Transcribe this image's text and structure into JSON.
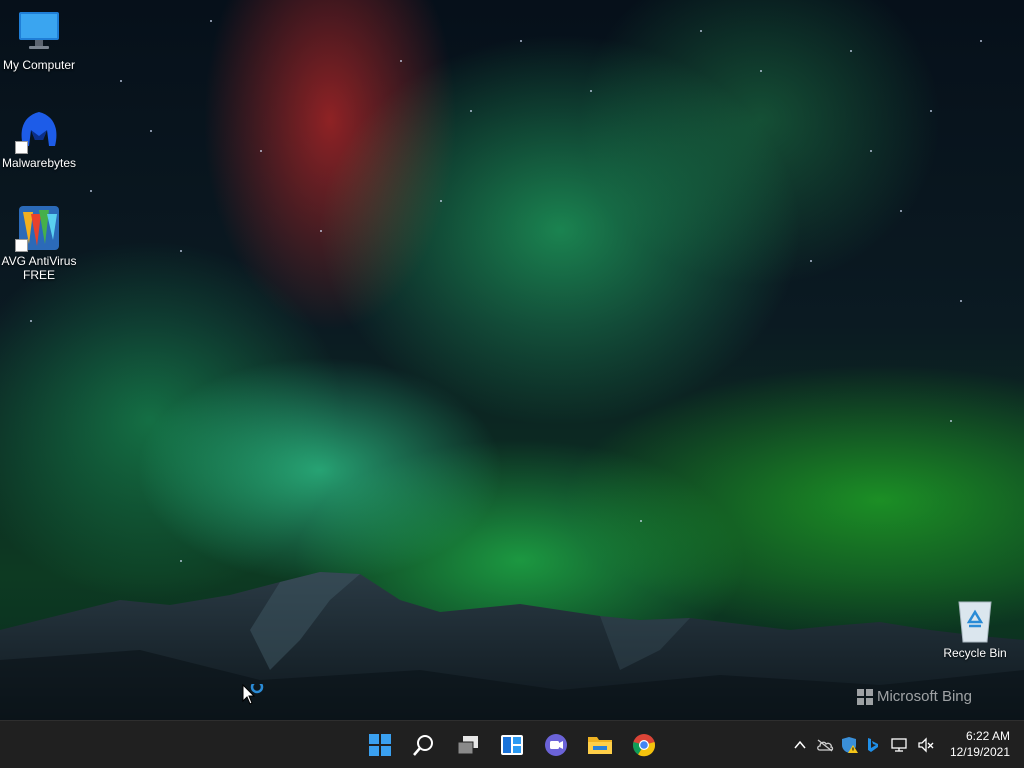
{
  "desktop": {
    "icons": [
      {
        "label": "My Computer"
      },
      {
        "label": "Malwarebytes"
      },
      {
        "label": "AVG AntiVirus FREE"
      },
      {
        "label": "Recycle Bin"
      }
    ],
    "watermark": "Microsoft Bing"
  },
  "taskbar": {
    "pinned": [
      {
        "icon": "windows-start-icon"
      },
      {
        "icon": "search-icon"
      },
      {
        "icon": "task-view-icon"
      },
      {
        "icon": "widgets-icon"
      },
      {
        "icon": "teams-chat-icon"
      },
      {
        "icon": "file-explorer-icon"
      },
      {
        "icon": "chrome-icon"
      }
    ],
    "tray": {
      "icons": [
        "chevron-up-icon",
        "onedrive-icon",
        "security-warning-icon",
        "bing-icon",
        "network-icon",
        "volume-muted-icon"
      ],
      "time": "6:22 AM",
      "date": "12/19/2021"
    }
  },
  "colors": {
    "taskbar": "#202020",
    "accent": "#0078d4"
  }
}
